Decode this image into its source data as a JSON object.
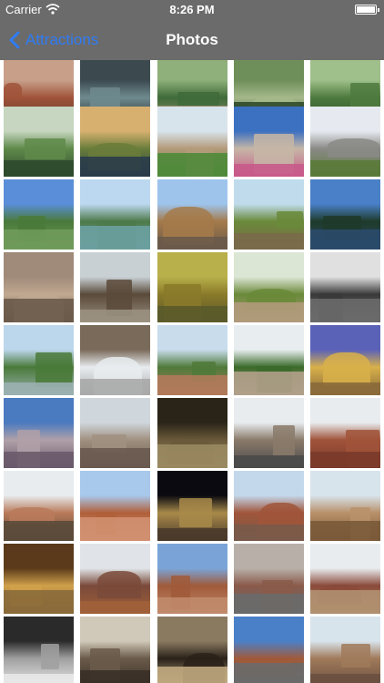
{
  "status_bar": {
    "carrier": "Carrier",
    "time": "8:26 PM",
    "wifi_icon": "wifi-icon",
    "battery_icon": "battery-icon"
  },
  "nav": {
    "back_label": "Attractions",
    "title": "Photos",
    "back_icon": "chevron-left-icon",
    "accent": "#2f7cf6",
    "bar_color": "#6b6b6b"
  },
  "grid": {
    "rows": [
      {
        "cells": [
          "photo-brick-church",
          "photo-dark-interior",
          "photo-garden-fountain",
          "photo-park-pond",
          "photo-park-lawn"
        ]
      },
      {
        "cells": [
          "photo-willow-pond",
          "photo-autumn-lake",
          "photo-villa-lawn",
          "photo-palace-flowers",
          "photo-castle-walls"
        ]
      },
      {
        "cells": [
          "photo-tree-pond",
          "photo-green-lake",
          "photo-bench-park",
          "photo-canal-trees",
          "photo-dark-lake"
        ]
      },
      {
        "cells": [
          "photo-city-panorama",
          "photo-bare-tree",
          "photo-yellow-woods",
          "photo-hay-bale",
          "photo-dark-garden"
        ]
      },
      {
        "cells": [
          "photo-park-fountain",
          "photo-snowy-ruins",
          "photo-villa-trees",
          "photo-fort-wall",
          "photo-duomo-gold"
        ]
      },
      {
        "cells": [
          "photo-duomo-facade",
          "photo-duomo-spires",
          "photo-church-nave",
          "photo-galleria",
          "photo-red-church"
        ]
      },
      {
        "cells": [
          "photo-bell-tower",
          "photo-brick-facade",
          "photo-night-church",
          "photo-church-square",
          "photo-brick-tower"
        ]
      },
      {
        "cells": [
          "photo-gold-apse",
          "photo-cloister",
          "photo-arched-hall",
          "photo-arcade-courtyard",
          "photo-dome-church"
        ]
      },
      {
        "cells": [
          "photo-fresco-wall",
          "photo-church-interior",
          "photo-vaulted-nave",
          "photo-basilica-front",
          "photo-stone-church"
        ]
      }
    ]
  }
}
